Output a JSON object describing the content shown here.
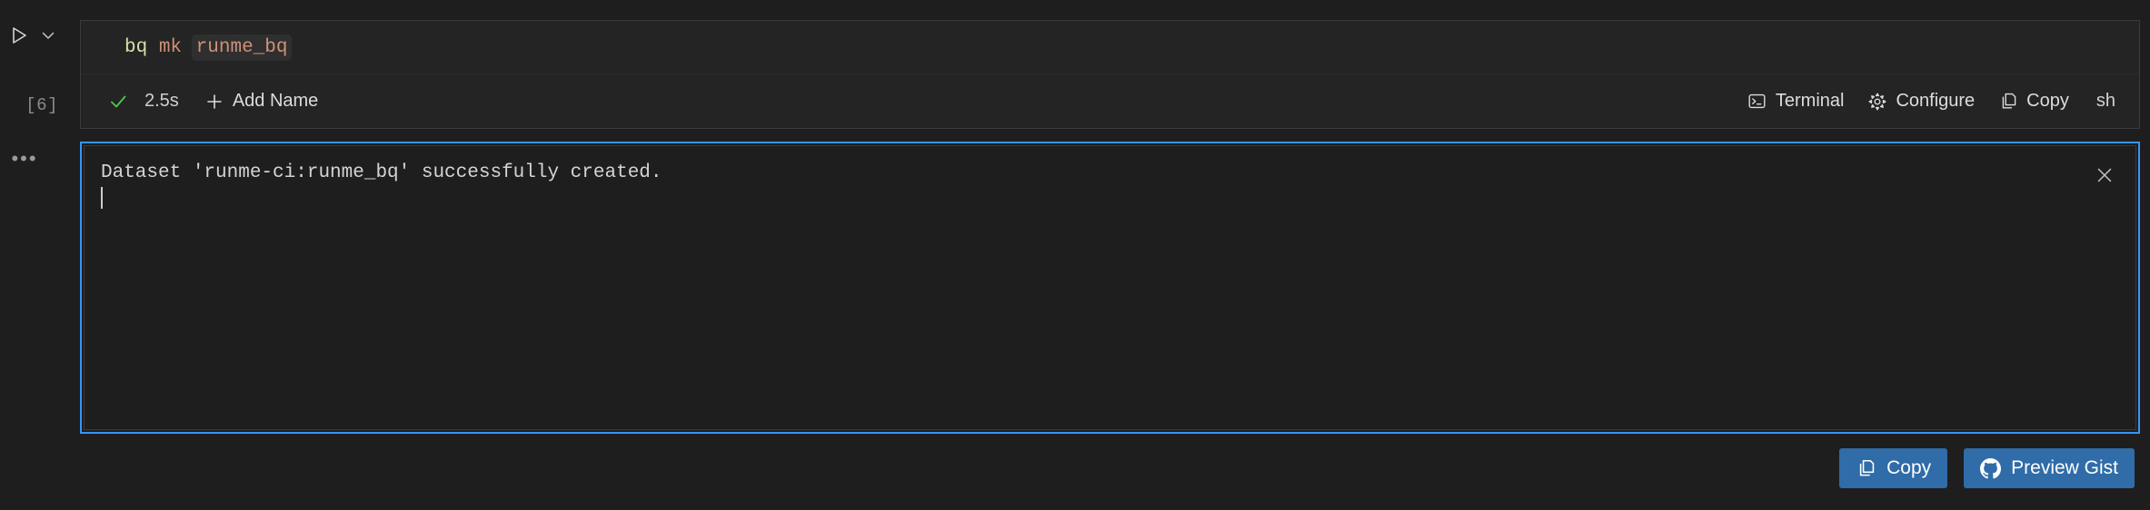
{
  "gutter": {
    "run_label": "run-cell",
    "chevron_label": "run-options",
    "execution_count": "[6]",
    "more_actions": "•••"
  },
  "cell": {
    "language": "sh",
    "code_tokens": [
      {
        "text": "bq",
        "kind": "command"
      },
      {
        "text": " ",
        "kind": "plain"
      },
      {
        "text": "mk",
        "kind": "subcommand"
      },
      {
        "text": " ",
        "kind": "plain"
      },
      {
        "text": "runme_bq",
        "kind": "argument"
      }
    ],
    "code_command": "bq",
    "code_subcommand": "mk",
    "code_argument": "runme_bq",
    "status": {
      "icon": "check-icon",
      "success_color": "#4ec94e",
      "duration": "2.5s",
      "add_name_label": "Add Name",
      "add_name_icon": "plus-icon"
    },
    "toolbar": [
      {
        "label": "Terminal",
        "icon": "terminal-icon"
      },
      {
        "label": "Configure",
        "icon": "gear-icon"
      },
      {
        "label": "Copy",
        "icon": "copy-icon"
      }
    ],
    "toolbar_terminal": "Terminal",
    "toolbar_configure": "Configure",
    "toolbar_copy": "Copy"
  },
  "output": {
    "text": "Dataset 'runme-ci:runme_bq' successfully created.",
    "close_icon": "close-icon",
    "focus_border_color": "#3794ff",
    "background_color": "#1e1e1e"
  },
  "footer": {
    "copy_label": "Copy",
    "copy_icon": "copy-icon",
    "preview_gist_label": "Preview Gist",
    "preview_gist_icon": "github-icon",
    "button_color": "#2f6ca8"
  }
}
